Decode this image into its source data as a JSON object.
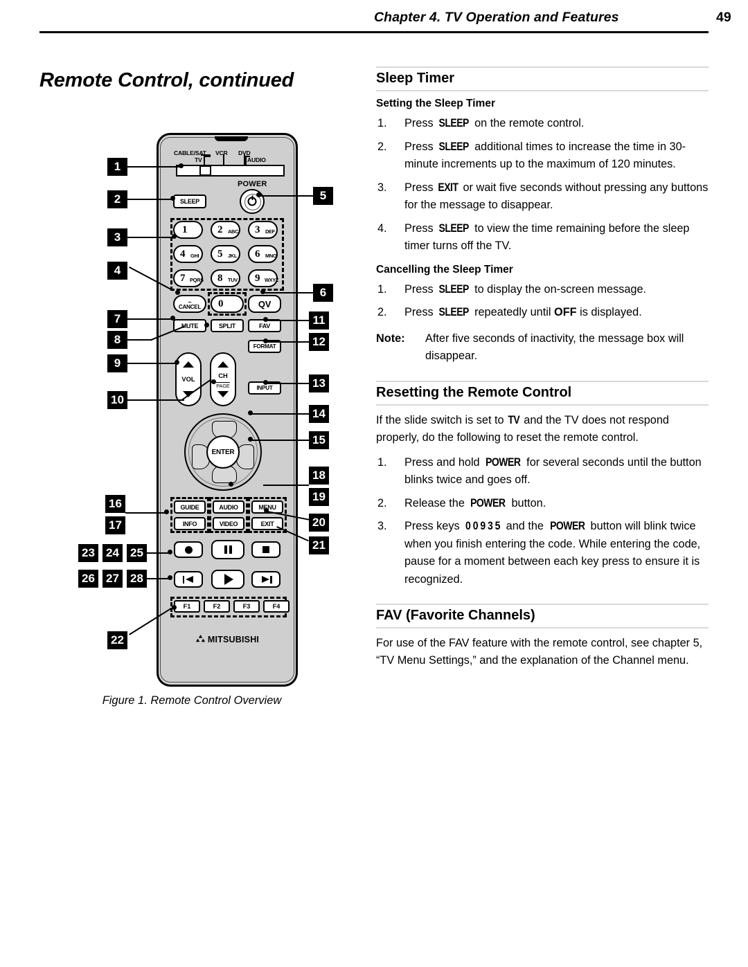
{
  "header": {
    "chapter": "Chapter 4. TV Operation and Features",
    "page_number": "49"
  },
  "page_title": "Remote Control, continued",
  "figure": {
    "caption": "Figure 1.  Remote Control Overview",
    "brand": "MITSUBISHI",
    "slide_switch": {
      "labels": [
        "CABLE/SAT",
        "TV",
        "VCR",
        "DVD",
        "AUDIO"
      ]
    },
    "power_label": "POWER",
    "sleep_label": "SLEEP",
    "numeric_keys": [
      {
        "digit": "1",
        "letters": ""
      },
      {
        "digit": "2",
        "letters": "ABC"
      },
      {
        "digit": "3",
        "letters": "DEF"
      },
      {
        "digit": "4",
        "letters": "GHI"
      },
      {
        "digit": "5",
        "letters": "JKL"
      },
      {
        "digit": "6",
        "letters": "MNO"
      },
      {
        "digit": "7",
        "letters": "PQRS"
      },
      {
        "digit": "8",
        "letters": "TUV"
      },
      {
        "digit": "9",
        "letters": "WXYZ"
      }
    ],
    "cancel_dash": "–",
    "cancel_label": "CANCEL",
    "zero_label": "0",
    "qv_label": "QV",
    "mute_label": "MUTE",
    "split_label": "SPLIT",
    "fav_label": "FAV",
    "format_label": "FORMAT",
    "input_label": "INPUT",
    "vol_label": "VOL",
    "ch_label": "CH",
    "page_label": "PAGE",
    "enter_label": "ENTER",
    "guide_label": "GUIDE",
    "audio_label": "AUDIO",
    "menu_label": "MENU",
    "info_label": "INFO",
    "video_label": "VIDEO",
    "exit_label": "EXIT",
    "function_keys": [
      "F1",
      "F2",
      "F3",
      "F4"
    ],
    "callouts_left": [
      "1",
      "2",
      "3",
      "4",
      "7",
      "8",
      "9",
      "10",
      "16",
      "17",
      "23",
      "24",
      "25",
      "26",
      "27",
      "28",
      "22"
    ],
    "callouts_right": [
      "5",
      "6",
      "11",
      "12",
      "13",
      "14",
      "15",
      "18",
      "19",
      "20",
      "21"
    ]
  },
  "sections": {
    "sleep_timer": {
      "heading": "Sleep Timer",
      "setting": {
        "heading": "Setting the Sleep Timer",
        "steps": [
          {
            "n": "1.",
            "parts": [
              {
                "t": "Press "
              },
              {
                "k": "SLEEP"
              },
              {
                "t": " on the remote control."
              }
            ]
          },
          {
            "n": "2.",
            "parts": [
              {
                "t": "Press "
              },
              {
                "k": "SLEEP"
              },
              {
                "t": " additional times to increase the time in 30-minute increments up to the maximum of 120 minutes."
              }
            ]
          },
          {
            "n": "3.",
            "parts": [
              {
                "t": "Press "
              },
              {
                "k": "EXIT"
              },
              {
                "t": " or wait five seconds without pressing any buttons for the message to disappear."
              }
            ]
          },
          {
            "n": "4.",
            "parts": [
              {
                "t": "Press "
              },
              {
                "k": "SLEEP"
              },
              {
                "t": " to view the time remaining before the sleep timer turns off the TV."
              }
            ]
          }
        ]
      },
      "cancelling": {
        "heading": "Cancelling the Sleep Timer",
        "steps": [
          {
            "n": "1.",
            "parts": [
              {
                "t": "Press "
              },
              {
                "k": "SLEEP"
              },
              {
                "t": " to display the on-screen message."
              }
            ]
          },
          {
            "n": "2.",
            "parts": [
              {
                "t": "Press "
              },
              {
                "k": "SLEEP"
              },
              {
                "t": " repeatedly until "
              },
              {
                "b": "OFF"
              },
              {
                "t": " is displayed."
              }
            ]
          }
        ]
      },
      "note": {
        "label": "Note:",
        "text": "After five seconds of inactivity, the message box will disappear."
      }
    },
    "resetting": {
      "heading": "Resetting the Remote Control",
      "intro_parts": [
        {
          "t": "If the slide switch is set to "
        },
        {
          "k": "TV"
        },
        {
          "t": " and the TV does not respond properly, do the following to reset the remote control."
        }
      ],
      "steps": [
        {
          "n": "1.",
          "parts": [
            {
              "t": "Press and hold "
            },
            {
              "k": "POWER"
            },
            {
              "t": " for several seconds until the button blinks twice and goes off."
            }
          ]
        },
        {
          "n": "2.",
          "parts": [
            {
              "t": "Release the "
            },
            {
              "k": "POWER"
            },
            {
              "t": " button."
            }
          ]
        },
        {
          "n": "3.",
          "parts": [
            {
              "t": "Press keys "
            },
            {
              "k": "0  0  9  3  5"
            },
            {
              "t": " and the "
            },
            {
              "k": "POWER"
            },
            {
              "t": " button will blink twice when you finish entering the code.  While entering the code, pause for a moment between each key press to ensure it is recognized."
            }
          ]
        }
      ]
    },
    "fav": {
      "heading": "FAV (Favorite Channels)",
      "text": "For use of the FAV feature with the remote control, see chapter 5, “TV Menu Settings,” and the explanation of the Channel menu."
    }
  }
}
